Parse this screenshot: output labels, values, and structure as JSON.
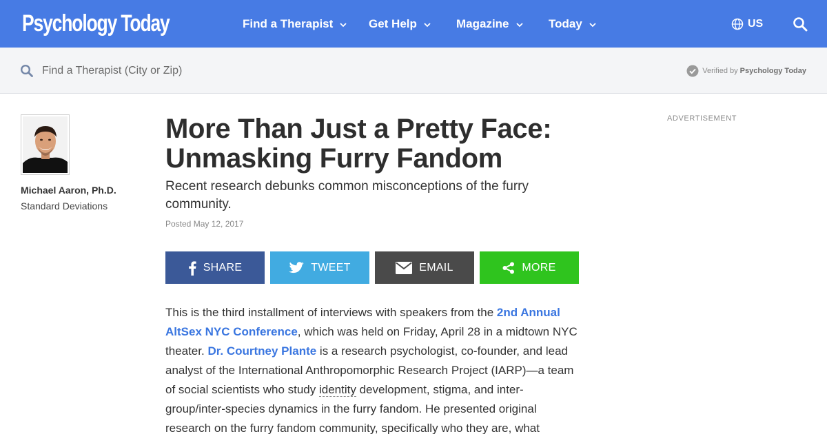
{
  "header": {
    "logo_text": "Psychology Today",
    "nav": [
      {
        "label": "Find a Therapist"
      },
      {
        "label": "Get Help"
      },
      {
        "label": "Magazine"
      },
      {
        "label": "Today"
      }
    ],
    "region_label": "US",
    "brand_color": "#477be4"
  },
  "findbar": {
    "placeholder": "Find a Therapist (City or Zip)",
    "verified_prefix": "Verified by",
    "verified_brand": "Psychology Today"
  },
  "author": {
    "name": "Michael Aaron, Ph.D.",
    "blog": "Standard Deviations"
  },
  "article": {
    "title": "More Than Just a Pretty Face: Unmasking Furry Fandom",
    "subtitle": "Recent research debunks common misconceptions of the furry community.",
    "posted": "Posted May 12, 2017",
    "share": {
      "facebook": "SHARE",
      "twitter": "TWEET",
      "email": "EMAIL",
      "more": "MORE"
    },
    "body": {
      "p1_a": "This is the third installment of interviews with speakers from the ",
      "link_conf": "2nd Annual AltSex NYC Conference",
      "p1_b": ", which was held on Friday, April 28 in a midtown NYC theater. ",
      "link_person": "Dr. Courtney Plante",
      "p1_c": " is a research psychologist, co-founder, and lead analyst of the International Anthropomorphic Research Project (IARP)—a team of social scientists who study ",
      "term_identity": "identity",
      "p1_d": " development, stigma, and inter-group/inter-species dynamics in the furry fandom. He presented original research on the furry fandom community, specifically who they are, what"
    }
  },
  "sidebar": {
    "ad_label": "ADVERTISEMENT"
  },
  "colors": {
    "facebook": "#3b5998",
    "twitter": "#41abe1",
    "email": "#4a4a4a",
    "more": "#2fc41e",
    "link": "#3a76e0"
  }
}
